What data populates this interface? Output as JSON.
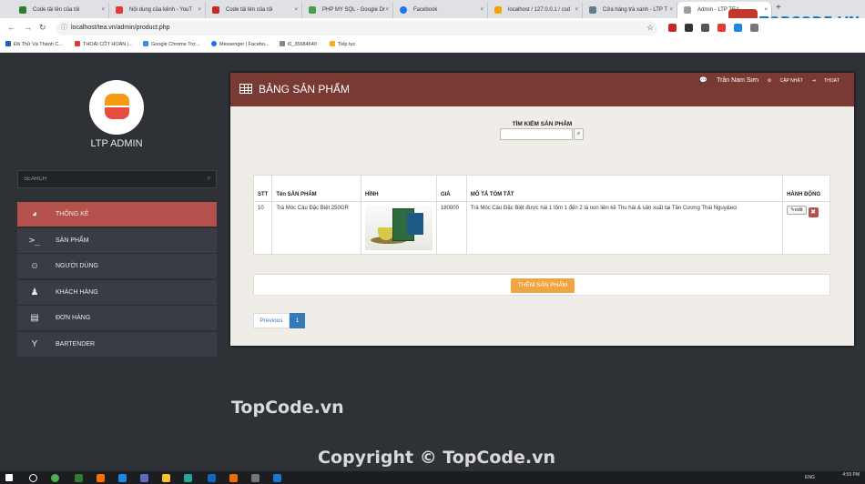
{
  "browser": {
    "tabs": [
      {
        "title": "Code tải lên của tôi",
        "color": "#2e7d32"
      },
      {
        "title": "Nội dung của kênh - YouT",
        "color": "#e53935"
      },
      {
        "title": "Code tải lên của tôi",
        "color": "#c62828"
      },
      {
        "title": "PHP MY SQL - Google Dr",
        "color": "#43a047"
      },
      {
        "title": "Facebook",
        "color": "#1877f2"
      },
      {
        "title": "localhost / 127.0.0.1 / csd",
        "color": "#f4a300"
      },
      {
        "title": "Cửa hàng trà xanh - LTP T",
        "color": "#607d8b"
      },
      {
        "title": "Admin - LTP TEA",
        "color": "#9e9e9e"
      }
    ],
    "url": "localhost/tea.vn/admin/product.php",
    "bookmarks": [
      "Đã Thử Và Thành C...",
      "THOÁI CỐT HOÀN |...",
      "Google Chrome Trợ...",
      "Messenger | Facebo...",
      "i0_35684640",
      "Tiếp tục"
    ],
    "brand": "TOPCODE.VN"
  },
  "sidebar": {
    "admin_name": "LTP ADMIN",
    "search_placeholder": "SEARCH",
    "items": [
      {
        "label": "THỐNG KÊ",
        "icon": "dashboard-icon"
      },
      {
        "label": "SẢN PHẨM",
        "icon": "terminal-icon"
      },
      {
        "label": "NGƯỜI DÙNG",
        "icon": "smile-icon"
      },
      {
        "label": "KHÁCH HÀNG",
        "icon": "user-icon"
      },
      {
        "label": "ĐƠN HÀNG",
        "icon": "credit-card-icon"
      },
      {
        "label": "BARTENDER",
        "icon": "cocktail-icon"
      }
    ]
  },
  "panel": {
    "title": "BẢNG SẢN PHẨM",
    "user_name": "Trần Nam Sơn",
    "update_label": "CẬP NHẬT",
    "logout_label": "THOÁT",
    "search_label": "TÌM KIẾM SẢN PHẨM",
    "table": {
      "headers": [
        "STT",
        "Tên SẢN PHẨM",
        "HÌNH",
        "GIÁ",
        "MÔ TẢ TÓM TẮT",
        "HÀNH ĐỘNG"
      ],
      "rows": [
        {
          "stt": "10",
          "name": "Trà Móc Câu Đặc Biệt 250GR",
          "price": "180000",
          "description": "Trà Móc Câu Đặc Biệt được hái 1 tôm 1 đến 2 lá non liền kề Thu hái & sản xuất tại Tân Cương Thái Nguy&eci",
          "edit_label": "edit"
        }
      ]
    },
    "add_button": "THÊM SẢN PHẨM",
    "pagination": {
      "prev": "Previous",
      "current": "1"
    }
  },
  "watermarks": [
    "TopCode.vn",
    "Copyright © TopCode.vn"
  ],
  "taskbar": {
    "time": "4:59 PM",
    "lang": "ENG"
  }
}
